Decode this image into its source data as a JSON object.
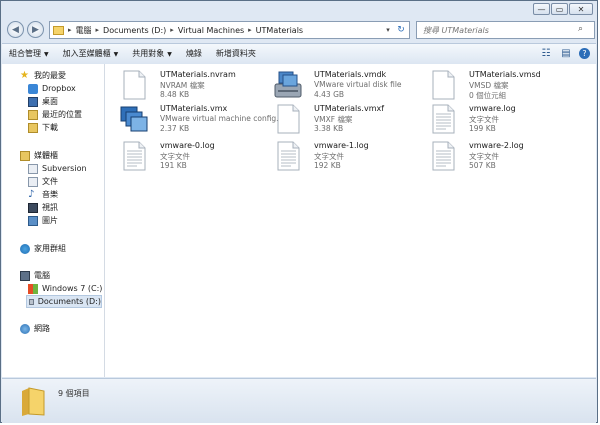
{
  "window": {
    "caption_buttons": {
      "minimize": "—",
      "maximize": "▭",
      "close": "✕"
    }
  },
  "address": {
    "segments": [
      "電腦",
      "Documents (D:)",
      "Virtual Machines",
      "UTMaterials"
    ],
    "back_icon": "back-arrow-icon",
    "forward_icon": "forward-arrow-icon"
  },
  "search": {
    "placeholder": "搜尋 UTMaterials"
  },
  "toolbar": {
    "organize": "組合管理",
    "include_library": "加入至媒體櫃",
    "share_with": "共用對象",
    "burn": "燒錄",
    "new_folder": "新增資料夾"
  },
  "nav": {
    "favorites": "我的最愛",
    "dropbox": "Dropbox",
    "desktop": "桌面",
    "recent": "最近的位置",
    "downloads": "下載",
    "libraries": "媒體櫃",
    "subversion": "Subversion",
    "documents": "文件",
    "music": "音樂",
    "videos": "視訊",
    "pictures": "圖片",
    "homegroup": "家用群組",
    "computer": "電腦",
    "windows7": "Windows 7 (C:)",
    "documents_d": "Documents (D:)",
    "network": "網路"
  },
  "files": [
    {
      "name": "UTMaterials.nvram",
      "type": "NVRAM 檔案",
      "size": "8.48 KB",
      "icon": "blank-file-icon"
    },
    {
      "name": "UTMaterials.vmdk",
      "type": "VMware virtual disk file",
      "size": "4.43 GB",
      "icon": "vmware-disk-icon"
    },
    {
      "name": "UTMaterials.vmsd",
      "type": "VMSD 檔案",
      "size": "0 個位元組",
      "icon": "blank-file-icon"
    },
    {
      "name": "UTMaterials.vmx",
      "type": "VMware virtual machine config...",
      "size": "2.37 KB",
      "icon": "vmware-config-icon"
    },
    {
      "name": "UTMaterials.vmxf",
      "type": "VMXF 檔案",
      "size": "3.38 KB",
      "icon": "blank-file-icon"
    },
    {
      "name": "vmware.log",
      "type": "文字文件",
      "size": "199 KB",
      "icon": "text-file-icon"
    },
    {
      "name": "vmware-0.log",
      "type": "文字文件",
      "size": "191 KB",
      "icon": "text-file-icon"
    },
    {
      "name": "vmware-1.log",
      "type": "文字文件",
      "size": "192 KB",
      "icon": "text-file-icon"
    },
    {
      "name": "vmware-2.log",
      "type": "文字文件",
      "size": "507 KB",
      "icon": "text-file-icon"
    }
  ],
  "status": {
    "count": "9 個項目"
  },
  "colors": {
    "chrome": "#dfe8f3",
    "accent": "#2b6db8",
    "folder": "#f5d36a"
  }
}
